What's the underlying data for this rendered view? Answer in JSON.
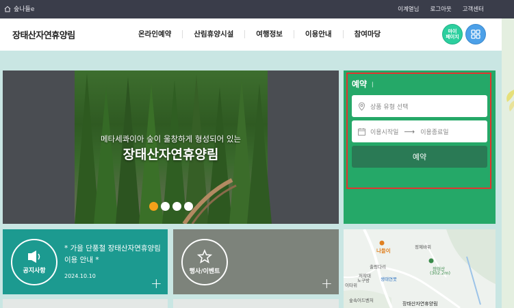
{
  "topbar": {
    "home_label": "숲나들e",
    "links": [
      "이계열님",
      "로그아웃",
      "고객센터"
    ]
  },
  "header": {
    "logo": "장태산자연휴양림",
    "nav": [
      "온라인예약",
      "산림휴양시설",
      "여행정보",
      "이용안내",
      "참여마당"
    ],
    "mypage_label": "마이\n페이지"
  },
  "hero": {
    "subtitle": "메타세콰이아 숲이 울창하게 형성되어 있는",
    "title": "장태산자연휴양림",
    "slides": 4,
    "active_slide": 1
  },
  "reserve": {
    "title": "예약",
    "title_mark": "ㅣ",
    "product_placeholder": "상품 유형 선택",
    "start_placeholder": "이용시작일",
    "end_placeholder": "이용종료일",
    "button": "예약"
  },
  "notice": {
    "label": "공지사항",
    "text": "* 가을 단풍철 장태산자연휴양림 이용 안내 *",
    "date": "2024.10.10",
    "more": "+"
  },
  "event": {
    "label": "행사/이벤트",
    "more": "+"
  },
  "map": {
    "labels": {
      "narai": "나들이",
      "jeongje": "정제바위",
      "chulgeungdari": "출렁다리",
      "jeojakdae": "저작대",
      "nogupang": "노구방",
      "saengtae": "생태연못",
      "itaba": "이타위",
      "jangtaesan": "장태산",
      "elevation": "(302.2m)",
      "sukei": "숲속어드벤처",
      "forest": "장태산자연휴양림"
    }
  },
  "colors": {
    "topbar": "#3a3d4a",
    "reserve_green": "#25a868",
    "notice_teal": "#1c9a90",
    "event_gray": "#7d837b",
    "active_dot": "#f4a11a",
    "highlight_frame": "#e3342f"
  }
}
